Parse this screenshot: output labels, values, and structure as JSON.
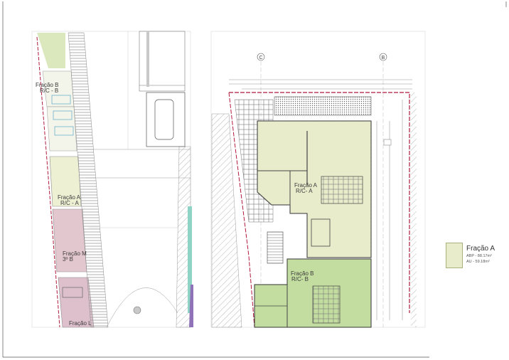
{
  "left_plan": {
    "units": [
      {
        "line1": "Fração B",
        "line2": "R/C - B"
      },
      {
        "line1": "Fração A",
        "line2": "R/C - A"
      },
      {
        "line1": "Fração M",
        "line2": "3º B"
      },
      {
        "line1": "Fração L",
        "line2": ""
      }
    ]
  },
  "right_plan": {
    "grid_axes": [
      "C",
      "B"
    ],
    "units": [
      {
        "line1": "Fração A",
        "line2": "R/C- A"
      },
      {
        "line1": "Fração B",
        "line2": "R/C- B"
      }
    ]
  },
  "legend": {
    "title": "Fração A",
    "abp": "ABP - 88.17m²",
    "au": "AU - 59.18m²"
  },
  "colors": {
    "unit_a_fill": "#e8eccb",
    "unit_b_fill": "#c3dda0",
    "unit_m_fill": "#e3c7cf",
    "unit_l_fill": "#ddc0cc",
    "boundary_red": "#b01b3c",
    "hatch_gray": "#9a9a9a"
  }
}
